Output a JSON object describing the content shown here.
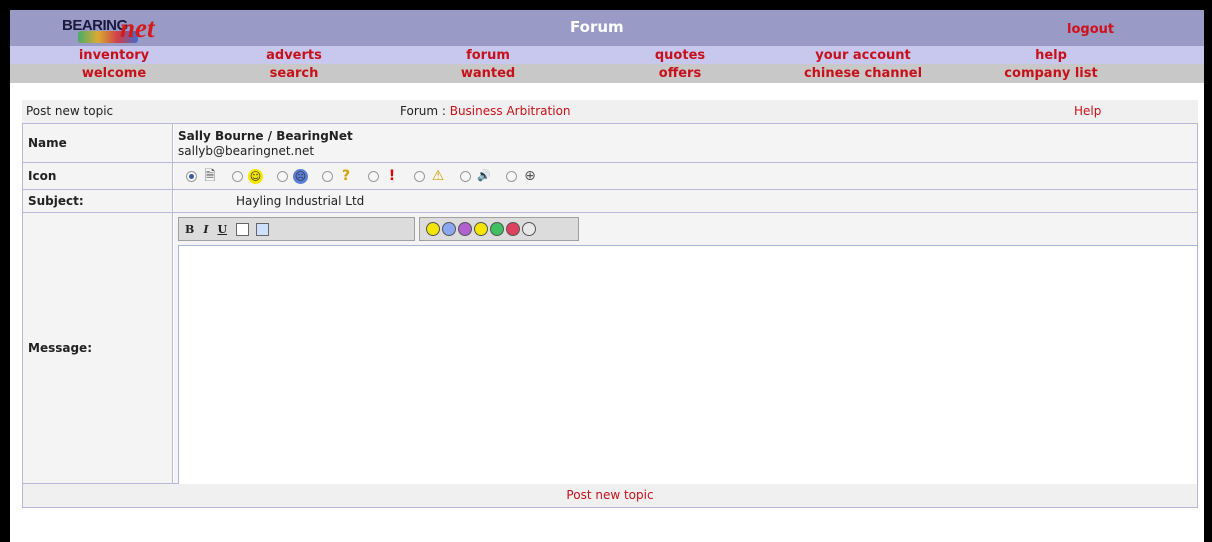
{
  "header": {
    "logo_text_1": "BEARING",
    "logo_text_2": "net",
    "title": "Forum",
    "logout_label": "logout"
  },
  "nav": {
    "row1": [
      "inventory",
      "adverts",
      "forum",
      "quotes",
      "your account",
      "help"
    ],
    "row2": [
      "welcome",
      "search",
      "wanted",
      "offers",
      "chinese channel",
      "company list"
    ]
  },
  "form": {
    "post_label": "Post new topic",
    "forum_prefix": "Forum : ",
    "forum_name": "Business Arbitration",
    "help_label": "Help",
    "name_label": "Name",
    "author": "Sally Bourne  / BearingNet",
    "email": "sallyb@bearingnet.net",
    "icon_label": "Icon",
    "subject_label": "Subject:",
    "subject_value": "Hayling Industrial Ltd",
    "message_label": "Message:",
    "submit_label": "Post new topic",
    "toolbar": {
      "bold": "B",
      "italic": "I",
      "underline": "U"
    }
  },
  "icons": [
    "document",
    "smile",
    "sad",
    "question",
    "exclamation",
    "warning",
    "sound",
    "crosshair"
  ],
  "colors": {
    "header": "#9a9ac6",
    "nav1": "#c8c8ee",
    "nav2": "#c8c8c8",
    "link": "#c8101a"
  }
}
